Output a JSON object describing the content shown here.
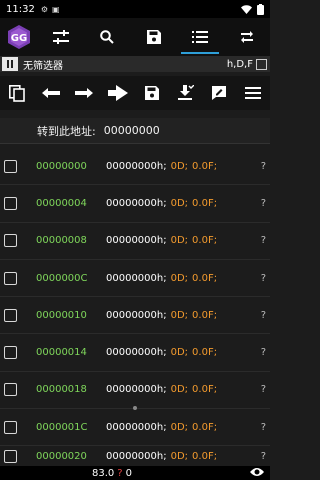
{
  "status": {
    "time": "11:32"
  },
  "topbar": {
    "tabs": [
      {
        "name": "settings-sliders-icon"
      },
      {
        "name": "search-icon"
      },
      {
        "name": "save-icon"
      },
      {
        "name": "list-icon",
        "active": true
      },
      {
        "name": "more-icon"
      }
    ]
  },
  "filter": {
    "label": "无筛选器",
    "type": "h,D,F"
  },
  "goto": {
    "label": "转到此地址:",
    "value": "00000000"
  },
  "rows": [
    {
      "addr": "00000000",
      "value": "00000000h;",
      "d": "0D;",
      "f": "0.0F;"
    },
    {
      "addr": "00000004",
      "value": "00000000h;",
      "d": "0D;",
      "f": "0.0F;"
    },
    {
      "addr": "00000008",
      "value": "00000000h;",
      "d": "0D;",
      "f": "0.0F;"
    },
    {
      "addr": "0000000C",
      "value": "00000000h;",
      "d": "0D;",
      "f": "0.0F;"
    },
    {
      "addr": "00000010",
      "value": "00000000h;",
      "d": "0D;",
      "f": "0.0F;"
    },
    {
      "addr": "00000014",
      "value": "00000000h;",
      "d": "0D;",
      "f": "0.0F;"
    },
    {
      "addr": "00000018",
      "value": "00000000h;",
      "d": "0D;",
      "f": "0.0F;"
    },
    {
      "addr": "0000001C",
      "value": "00000000h;",
      "d": "0D;",
      "f": "0.0F;"
    },
    {
      "addr": "00000020",
      "value": "00000000h;",
      "d": "0D;",
      "f": "0.0F;"
    }
  ],
  "bottom": {
    "stat": "83.0",
    "stat2": "0"
  },
  "colors": {
    "accent": "#2e9fd8",
    "address": "#7fd65b",
    "type": "#f29a2e"
  }
}
